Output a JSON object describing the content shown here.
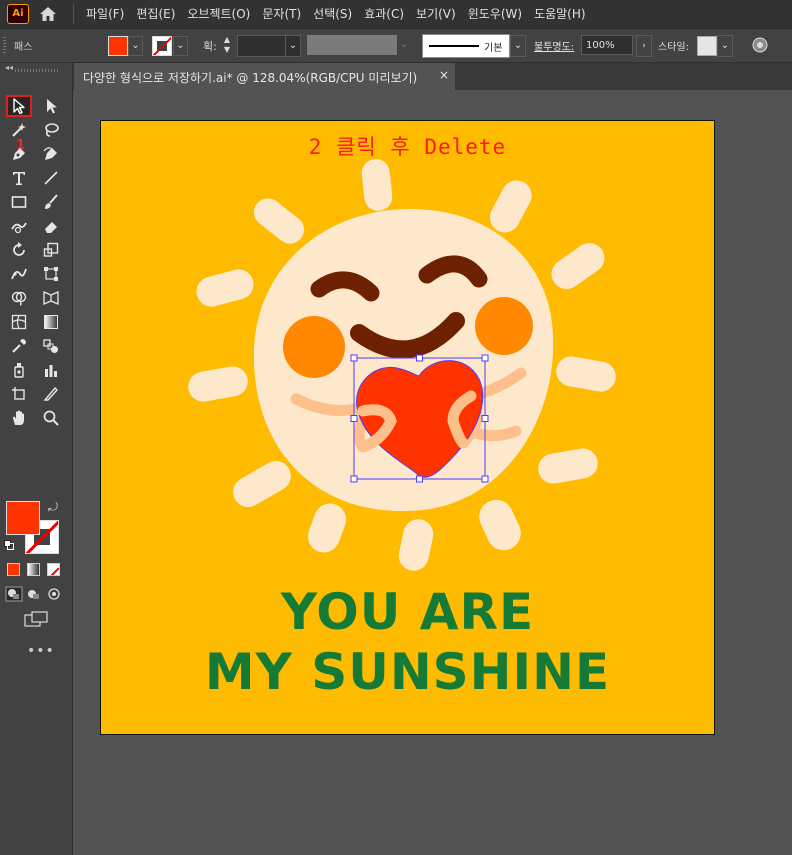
{
  "menubar": {
    "logo": "Ai",
    "items": [
      "파일(F)",
      "편집(E)",
      "오브젝트(O)",
      "문자(T)",
      "선택(S)",
      "효과(C)",
      "보기(V)",
      "윈도우(W)",
      "도움말(H)"
    ]
  },
  "control": {
    "path_label": "패스",
    "weight_label": "획:",
    "profile_label": "기본",
    "opacity_label": "불투명도:",
    "opacity_value": "100%",
    "style_label": "스타일:",
    "fill_color": "#ff3300",
    "style_color": "#e6e6e6"
  },
  "toolbox": {
    "marker": "1",
    "fill_color": "#ff3300",
    "selected_tool": "selection-tool"
  },
  "document": {
    "tab_title": "다양한 형식으로 저장하기.ai* @ 128.04%(RGB/CPU 미리보기)",
    "tab_close": "×"
  },
  "artboard": {
    "annotation": "2 클릭 후 Delete",
    "line1": "YOU ARE",
    "line2": "MY SUNSHINE",
    "background": "#ffbb00",
    "sun_color": "#fde8cc",
    "cheek_color": "#ff8800",
    "face_color": "#6e2100",
    "heart_color": "#ff3300",
    "arm_color": "#fdc08a",
    "text_color": "#157a35"
  }
}
